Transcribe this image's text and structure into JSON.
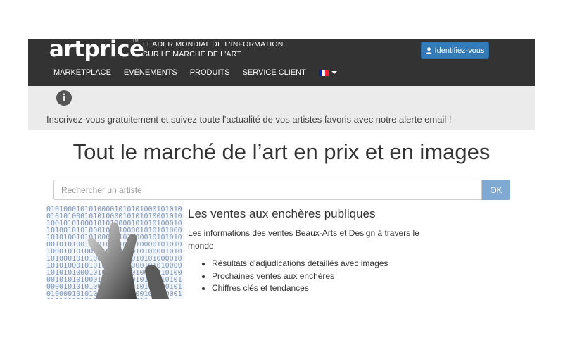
{
  "header": {
    "logo": "artprice",
    "logo_tm": "TM",
    "tagline_line1": "LEADER MONDIAL DE L'INFORMATION",
    "tagline_line2": "SUR LE MARCHE DE L'ART",
    "login_label": "Identifiez-vous",
    "nav": [
      "MARKETPLACE",
      "EVÉNEMENTS",
      "PRODUITS",
      "SERVICE CLIENT"
    ],
    "language_flag": "fr-flag-icon"
  },
  "alert": {
    "icon": "info-icon",
    "text": "Inscrivez-vous gratuitement et suivez toute l'actualité de vos artistes favoris avec notre alerte email !"
  },
  "main": {
    "headline": "Tout le marché de l’art en prix et en images",
    "search_placeholder": "Rechercher un artiste",
    "search_button": "OK"
  },
  "section": {
    "title": "Les ventes aux enchères publiques",
    "description": "Les informations des ventes Beaux-Arts et Design à travers le monde",
    "bullets": [
      "Résultats d'adjudications détaillés avec images",
      "Prochaines ventes aux enchères",
      "Chiffres clés et tendances"
    ]
  },
  "colors": {
    "header_bg": "#333333",
    "alert_bg": "#ebebeb",
    "primary_button": "#337ab7",
    "ok_button": "#7fa9d3"
  }
}
